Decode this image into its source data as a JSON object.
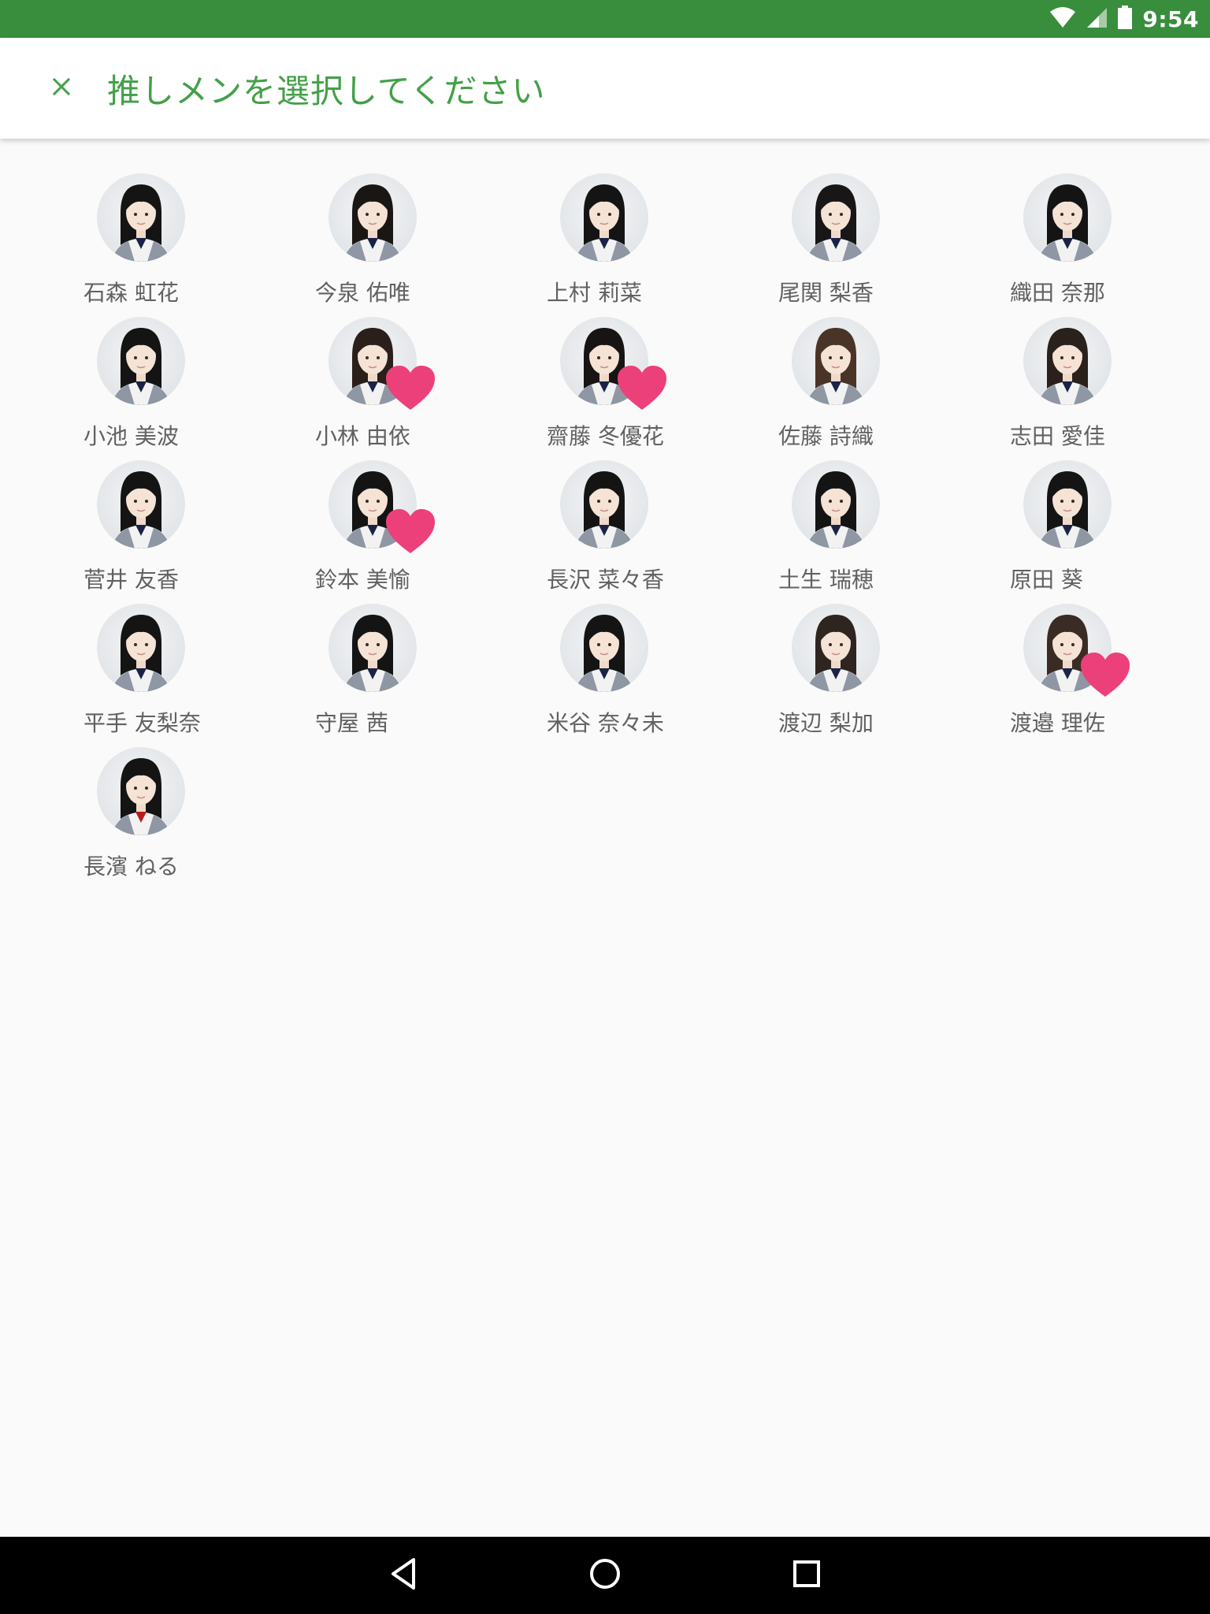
{
  "status_bar": {
    "time": "9:54",
    "icons": [
      "wifi-icon",
      "cell-signal-icon",
      "battery-icon"
    ],
    "color": "#388e3c"
  },
  "app_bar": {
    "close_icon": "close-icon",
    "title": "推しメンを選択してください",
    "accent_color": "#43a047"
  },
  "members": [
    {
      "name": "石森 虹花",
      "selected": false,
      "hair": "#141414"
    },
    {
      "name": "今泉 佑唯",
      "selected": false,
      "hair": "#1a1614"
    },
    {
      "name": "上村 莉菜",
      "selected": false,
      "hair": "#141414"
    },
    {
      "name": "尾関 梨香",
      "selected": false,
      "hair": "#181616"
    },
    {
      "name": "織田 奈那",
      "selected": false,
      "hair": "#141414"
    },
    {
      "name": "小池 美波",
      "selected": false,
      "hair": "#141414"
    },
    {
      "name": "小林 由依",
      "selected": true,
      "hair": "#2a1f1a"
    },
    {
      "name": "齋藤 冬優花",
      "selected": true,
      "hair": "#181414"
    },
    {
      "name": "佐藤 詩織",
      "selected": false,
      "hair": "#4a3428"
    },
    {
      "name": "志田 愛佳",
      "selected": false,
      "hair": "#2a201c"
    },
    {
      "name": "菅井 友香",
      "selected": false,
      "hair": "#141414"
    },
    {
      "name": "鈴本 美愉",
      "selected": true,
      "hair": "#141414"
    },
    {
      "name": "長沢 菜々香",
      "selected": false,
      "hair": "#141414"
    },
    {
      "name": "土生 瑞穂",
      "selected": false,
      "hair": "#141414"
    },
    {
      "name": "原田 葵",
      "selected": false,
      "hair": "#141414"
    },
    {
      "name": "平手 友梨奈",
      "selected": false,
      "hair": "#141414"
    },
    {
      "name": "守屋 茜",
      "selected": false,
      "hair": "#141414"
    },
    {
      "name": "米谷 奈々未",
      "selected": false,
      "hair": "#141414"
    },
    {
      "name": "渡辺 梨加",
      "selected": false,
      "hair": "#2e2420"
    },
    {
      "name": "渡邉 理佐",
      "selected": true,
      "hair": "#3a2c24"
    },
    {
      "name": "長濱 ねる",
      "selected": false,
      "hair": "#141414",
      "tie": "#b71c1c"
    }
  ],
  "selected_heart_color": "#ec407a",
  "nav_bar": {
    "buttons": [
      "back-icon",
      "home-icon",
      "recents-icon"
    ]
  }
}
